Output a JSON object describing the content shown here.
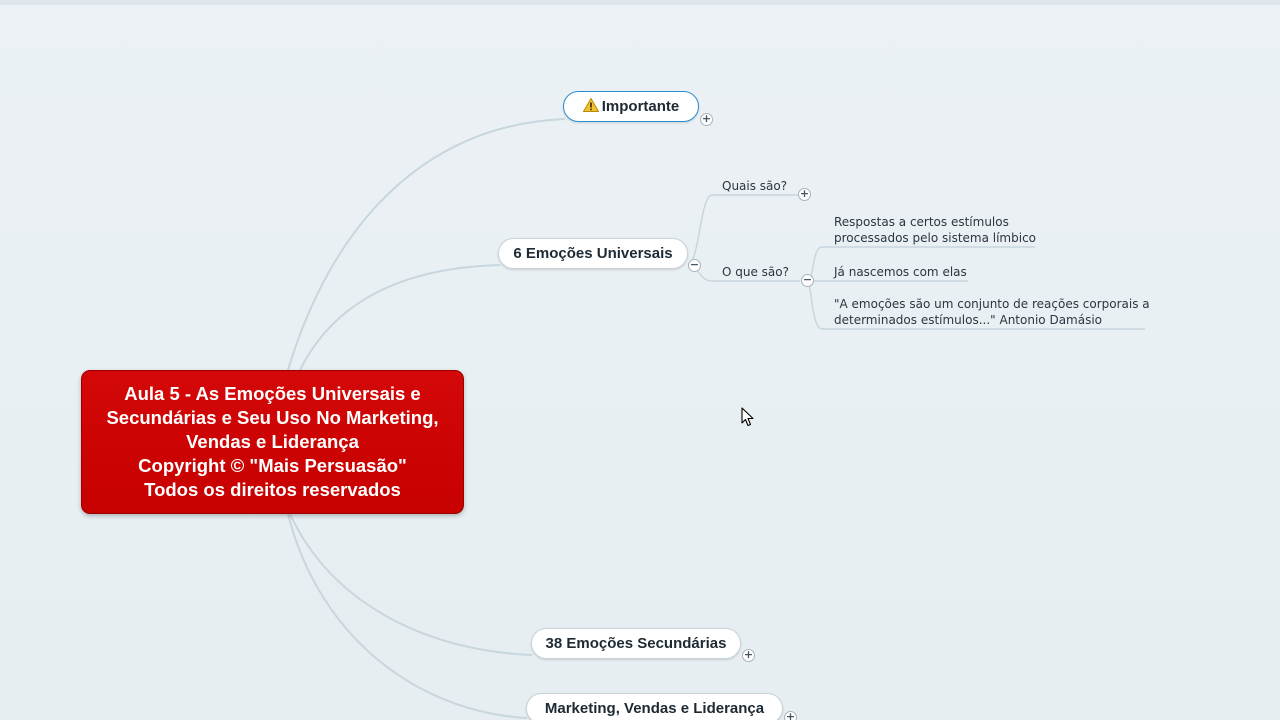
{
  "central_topic": {
    "lines": [
      "Aula 5 - As Emoções Universais e",
      "Secundárias e Seu Uso No Marketing,",
      "Vendas e Liderança",
      "Copyright © \"Mais Persuasão\"",
      "Todos os direitos reservados"
    ],
    "color": "#cc0000"
  },
  "main_topics": {
    "importante": {
      "label": "Importante",
      "icon": "warning-icon",
      "toggle": "+"
    },
    "emocoes_universais": {
      "label": "6 Emoções Universais",
      "toggle": "−"
    },
    "emocoes_secundarias": {
      "label": "38 Emoções Secundárias",
      "toggle": "+"
    },
    "marketing": {
      "label": "Marketing, Vendas e Liderança",
      "toggle": "+"
    }
  },
  "subtopics": {
    "quais_sao": {
      "label": "Quais são?",
      "toggle": "+"
    },
    "o_que_sao": {
      "label": "O que são?",
      "toggle": "−"
    }
  },
  "details": {
    "respostas_line1": "Respostas a certos estímulos",
    "respostas_line2": "processados pelo sistema límbico",
    "ja_nascemos": "Já nascemos com elas",
    "damasio_line1": "\"A emoções são um conjunto de reações corporais a",
    "damasio_line2": "determinados estímulos...\" Antonio Damásio"
  },
  "colors": {
    "background": "#e8eff3",
    "connector": "#c8d6de",
    "selection": "#2a8fd0"
  }
}
